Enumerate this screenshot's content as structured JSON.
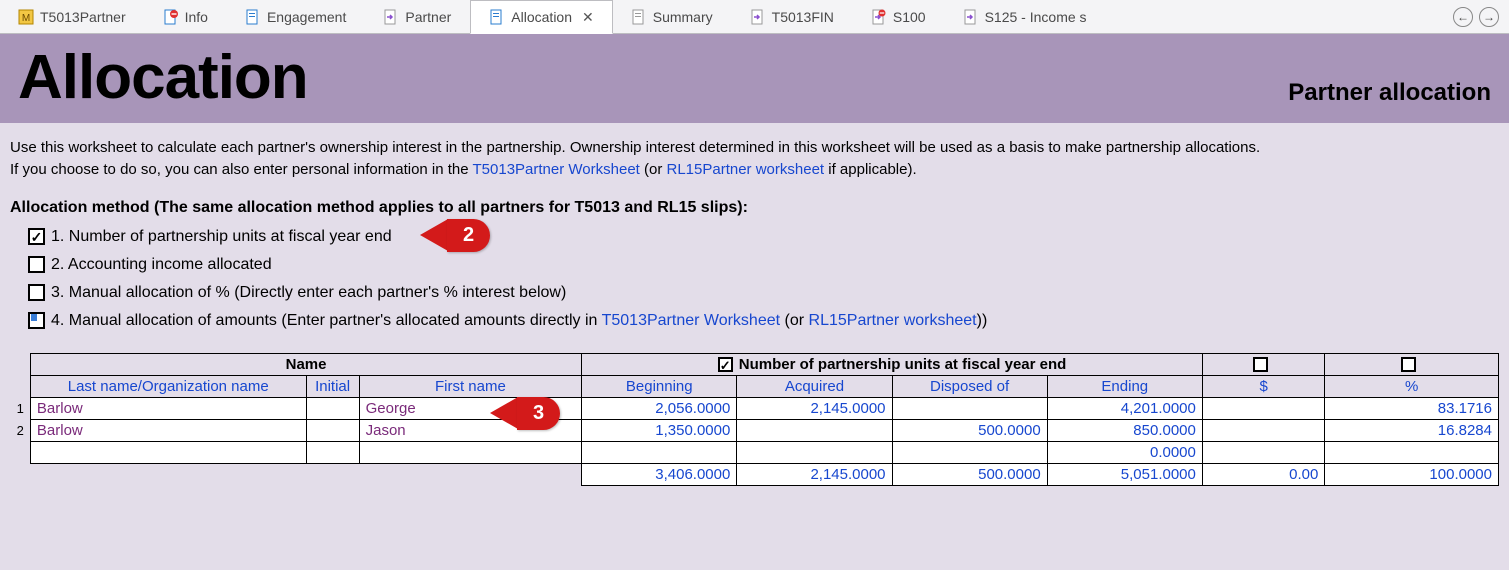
{
  "tabs": [
    {
      "label": "T5013Partner",
      "icon": "m-file"
    },
    {
      "label": "Info",
      "icon": "doc-red"
    },
    {
      "label": "Engagement",
      "icon": "doc-blue"
    },
    {
      "label": "Partner",
      "icon": "doc-arrow"
    },
    {
      "label": "Allocation",
      "icon": "doc-blue",
      "active": true
    },
    {
      "label": "Summary",
      "icon": "doc-blue"
    },
    {
      "label": "T5013FIN",
      "icon": "doc-arrow"
    },
    {
      "label": "S100",
      "icon": "doc-arrow-red"
    },
    {
      "label": "S125 - Income s",
      "icon": "doc-arrow"
    }
  ],
  "close_glyph": "✕",
  "nav_prev": "←",
  "nav_next": "→",
  "header": {
    "title": "Allocation",
    "subtitle": "Partner allocation"
  },
  "intro": {
    "line1": "Use this worksheet to calculate each partner's ownership interest in the partnership. Ownership interest determined in this worksheet will be used as a basis to make partnership allocations.",
    "line2a": "If you choose to do so, you can also enter personal information in the ",
    "link1": "T5013Partner Worksheet",
    "line2b": " (or ",
    "link2": "RL15Partner worksheet",
    "line2c": " if applicable)."
  },
  "section_heading": "Allocation method (The same allocation method applies to all partners for T5013 and RL15 slips):",
  "methods": {
    "m1": "1. Number of partnership units at fiscal year end",
    "m2": "2. Accounting income allocated",
    "m3": "3. Manual allocation of % (Directly enter each partner's % interest below)",
    "m4a": "4. Manual allocation of amounts (Enter partner's allocated amounts directly in ",
    "m4link1": "T5013Partner Worksheet",
    "m4b": " (or ",
    "m4link2": "RL15Partner worksheet",
    "m4c": "))"
  },
  "callouts": {
    "c2": "2",
    "c3": "3"
  },
  "table": {
    "group_name": "Name",
    "group_units": "Number of partnership units at fiscal year end",
    "col_lastname": "Last name/Organization name",
    "col_initial": "Initial",
    "col_firstname": "First name",
    "col_begin": "Beginning",
    "col_acq": "Acquired",
    "col_disp": "Disposed of",
    "col_end": "Ending",
    "col_money": "$",
    "col_pct": "%",
    "rows": [
      {
        "n": "1",
        "last": "Barlow",
        "init": "",
        "first": "George",
        "begin": "2,056.0000",
        "acq": "2,145.0000",
        "disp": "",
        "end": "4,201.0000",
        "money": "",
        "pct": "83.1716"
      },
      {
        "n": "2",
        "last": "Barlow",
        "init": "",
        "first": "Jason",
        "begin": "1,350.0000",
        "acq": "",
        "disp": "500.0000",
        "end": "850.0000",
        "money": "",
        "pct": "16.8284"
      }
    ],
    "extra_end": "0.0000",
    "totals": {
      "begin": "3,406.0000",
      "acq": "2,145.0000",
      "disp": "500.0000",
      "end": "5,051.0000",
      "money": "0.00",
      "pct": "100.0000"
    }
  }
}
